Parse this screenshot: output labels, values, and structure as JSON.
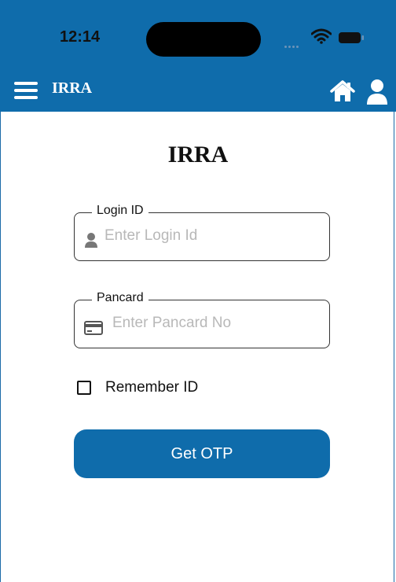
{
  "status_bar": {
    "time": "12:14"
  },
  "app_bar": {
    "title": "IRRA"
  },
  "page": {
    "title": "IRRA"
  },
  "login_id": {
    "label": "Login ID",
    "placeholder": "Enter Login Id",
    "value": ""
  },
  "pancard": {
    "label": "Pancard",
    "placeholder": "Enter Pancard No",
    "value": ""
  },
  "remember": {
    "label": "Remember ID",
    "checked": false
  },
  "submit": {
    "label": "Get OTP"
  },
  "colors": {
    "primary": "#0f6cab",
    "text": "#111111",
    "placeholder": "#b8b8b8"
  }
}
